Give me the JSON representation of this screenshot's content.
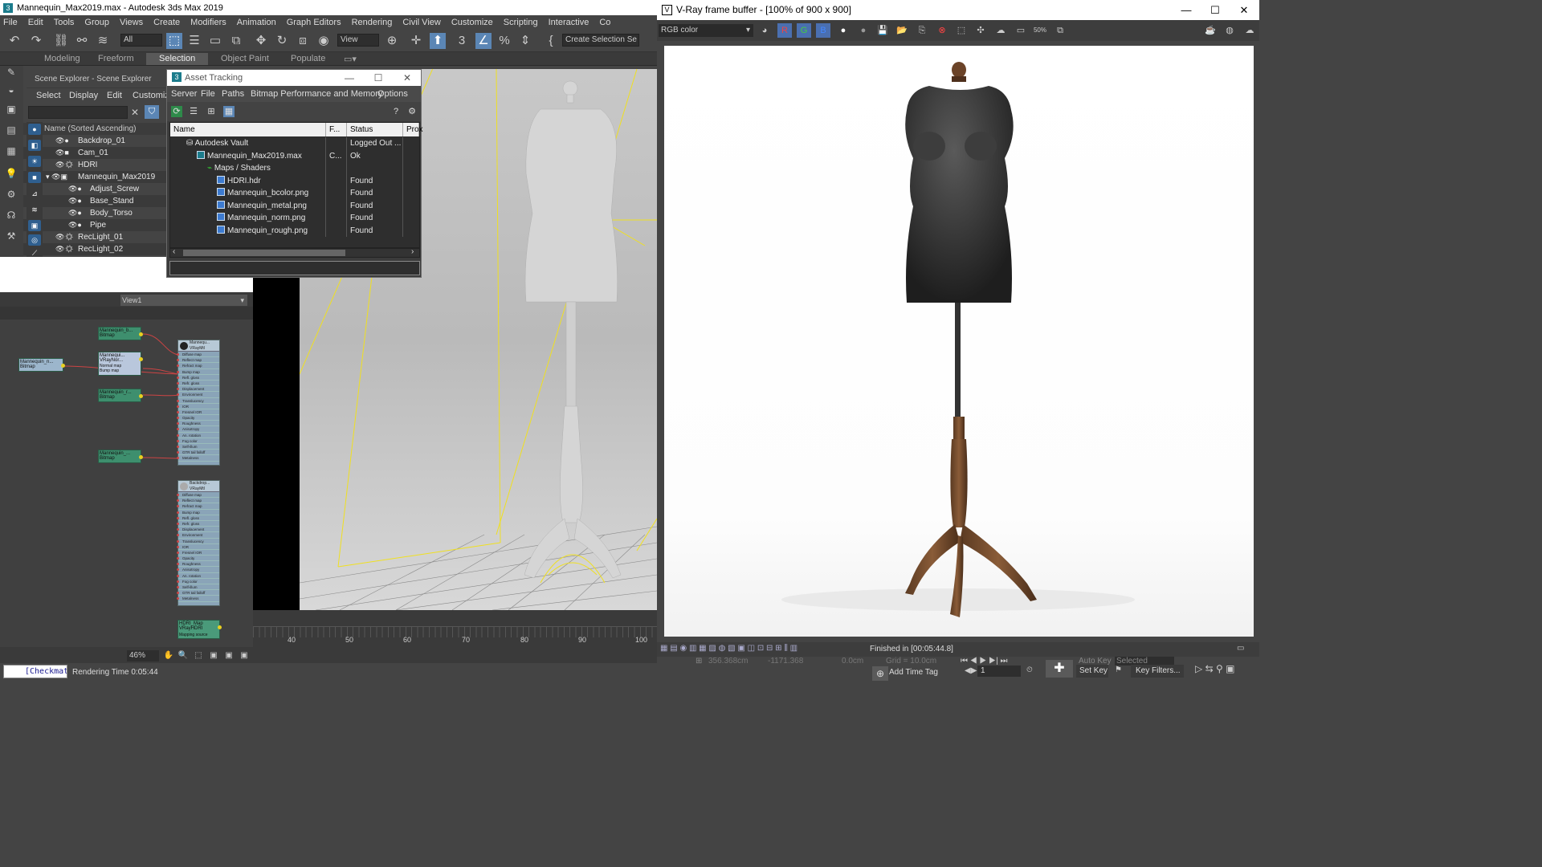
{
  "max": {
    "title": "Mannequin_Max2019.max - Autodesk 3ds Max 2019",
    "menu": [
      "File",
      "Edit",
      "Tools",
      "Group",
      "Views",
      "Create",
      "Modifiers",
      "Animation",
      "Graph Editors",
      "Rendering",
      "Civil View",
      "Customize",
      "Scripting",
      "Interactive",
      "Co"
    ],
    "toolbar": {
      "filter": "All",
      "view": "View",
      "selection_set": "Create Selection Se"
    },
    "ribbon": [
      "Modeling",
      "Freeform",
      "Selection",
      "Object Paint",
      "Populate"
    ],
    "ribbon_selected": "Selection"
  },
  "scene_explorer": {
    "title": "Scene Explorer - Scene Explorer",
    "menu": [
      "Select",
      "Display",
      "Edit",
      "Customiz"
    ],
    "column": "Name (Sorted Ascending)",
    "rows": [
      "Backdrop_01",
      "Cam_01",
      "HDRI",
      "Mannequin_Max2019",
      "Adjust_Screw",
      "Base_Stand",
      "Body_Torso",
      "Pipe",
      "RecLight_01",
      "RecLight_02"
    ]
  },
  "asset_tracking": {
    "title": "Asset Tracking",
    "menu": [
      "Server",
      "File",
      "Paths",
      "Bitmap Performance and Memory",
      "Options"
    ],
    "columns": [
      "Name",
      "F...",
      "Status",
      "Prox"
    ],
    "rows": [
      {
        "name": "Autodesk Vault",
        "f": "",
        "status": "Logged Out ..."
      },
      {
        "name": "Mannequin_Max2019.max",
        "f": "C...",
        "status": "Ok"
      },
      {
        "name": "Maps / Shaders",
        "f": "",
        "status": ""
      },
      {
        "name": "HDRI.hdr",
        "f": "",
        "status": "Found"
      },
      {
        "name": "Mannequin_bcolor.png",
        "f": "",
        "status": "Found"
      },
      {
        "name": "Mannequin_metal.png",
        "f": "",
        "status": "Found"
      },
      {
        "name": "Mannequin_norm.png",
        "f": "",
        "status": "Found"
      },
      {
        "name": "Mannequin_rough.png",
        "f": "",
        "status": "Found"
      }
    ]
  },
  "slate": {
    "view": "View1",
    "zoom": "46%",
    "nodes": {
      "n1": "Mannequin_b... Bitmap",
      "n2": "Mannequi... VRayNor...",
      "n3": "Mannequin_n... Bitmap",
      "n4": "Mannequin_r... Bitmap",
      "n5": "Mannequin_... Bitmap",
      "n2_slot1": "Normal map",
      "n2_slot2": "Bump map",
      "mtl1": "Mannequ... VRayMtl",
      "mtl2": "Backdrop... VRayMtl",
      "hdri": "HDRI_Map VRayHDRI",
      "hdri_slot": "Mapping source"
    },
    "mtl_slots": [
      "Diffuse map",
      "Reflect map",
      "Refract map",
      "Bump map",
      "Refl. gloss",
      "Refr. gloss",
      "Displacement",
      "Environment",
      "Translucency",
      "IOR",
      "Fresnel IOR",
      "Opacity",
      "Roughness",
      "Anisotropy",
      "An. rotation",
      "Fog color",
      "Self-illum",
      "GTR tail falloff",
      "Metalness"
    ]
  },
  "status": {
    "listener": "[Checkmate",
    "render_time": "Rendering Time  0:05:44"
  },
  "timeline": {
    "ticks": [
      "40",
      "50",
      "60",
      "70",
      "80",
      "90",
      "100"
    ]
  },
  "vfb": {
    "title": "V-Ray frame buffer - [100% of 900 x 900]",
    "channel": "RGB color",
    "status": "Finished in [00:05:44.8]"
  },
  "bottom_bar": {
    "autokey": "Auto Key",
    "selected": "Selected",
    "setkey": "Set Key",
    "keyfilters": "Key Filters...",
    "addtimetag": "Add Time Tag",
    "frame": "1",
    "x": "356.368cm",
    "y": "-1171.368",
    "z": "0.0cm",
    "grid": "Grid = 10.0cm"
  },
  "colors": {
    "accent": "#5b86b5",
    "node_green": "#3e8f6e",
    "wire": "#e0d020"
  }
}
